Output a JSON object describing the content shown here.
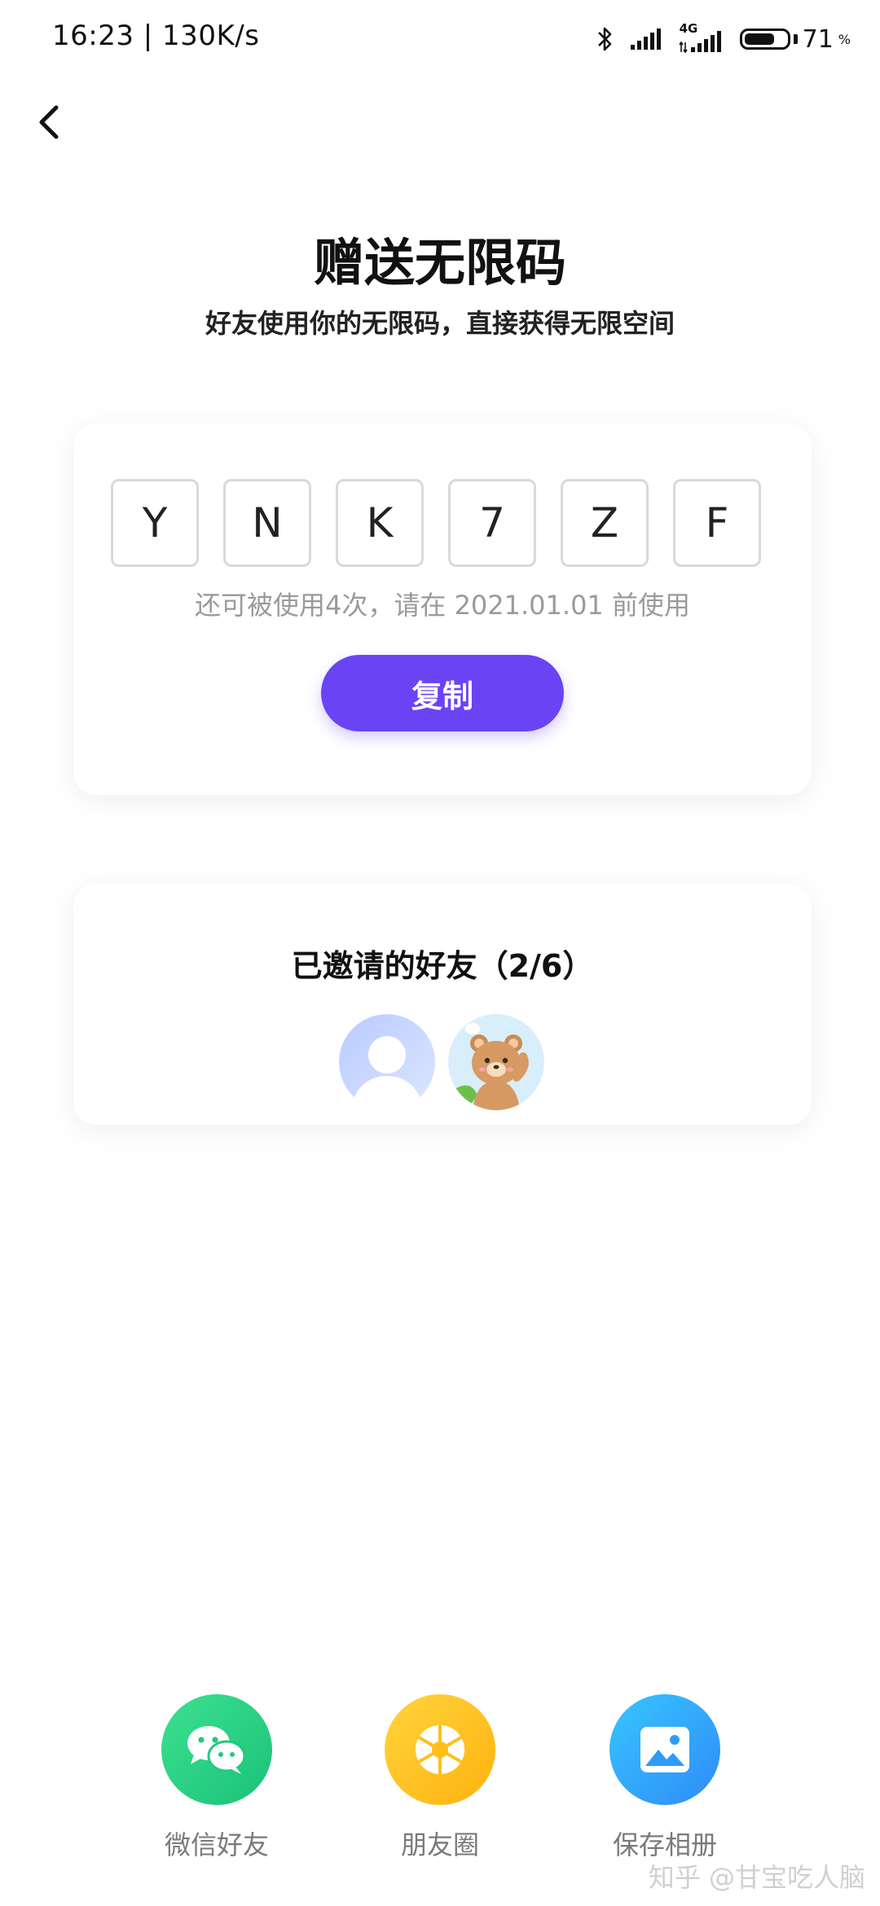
{
  "status_bar": {
    "time_speed": "16:23 | 130K/s",
    "network": "4G",
    "battery_percent": "71",
    "battery_unit": "%",
    "battery_level": 0.71
  },
  "header": {
    "title": "赠送无限码",
    "subtitle": "好友使用你的无限码，直接获得无限空间"
  },
  "code_card": {
    "code_chars": [
      "Y",
      "N",
      "K",
      "7",
      "Z",
      "F"
    ],
    "hint": "还可被使用4次，请在 2021.01.01 前使用",
    "copy_label": "复制",
    "accent_color": "#6a43f5"
  },
  "friends_card": {
    "title": "已邀请的好友（2/6）"
  },
  "share": {
    "items": [
      {
        "label": "微信好友",
        "icon": "wechat-icon",
        "color": "#23cc80"
      },
      {
        "label": "朋友圈",
        "icon": "moments-aperture-icon",
        "color": "#ffc21f"
      },
      {
        "label": "保存相册",
        "icon": "image-icon",
        "color": "#34a9fb"
      }
    ]
  },
  "watermark": "知乎 @甘宝吃人脑"
}
